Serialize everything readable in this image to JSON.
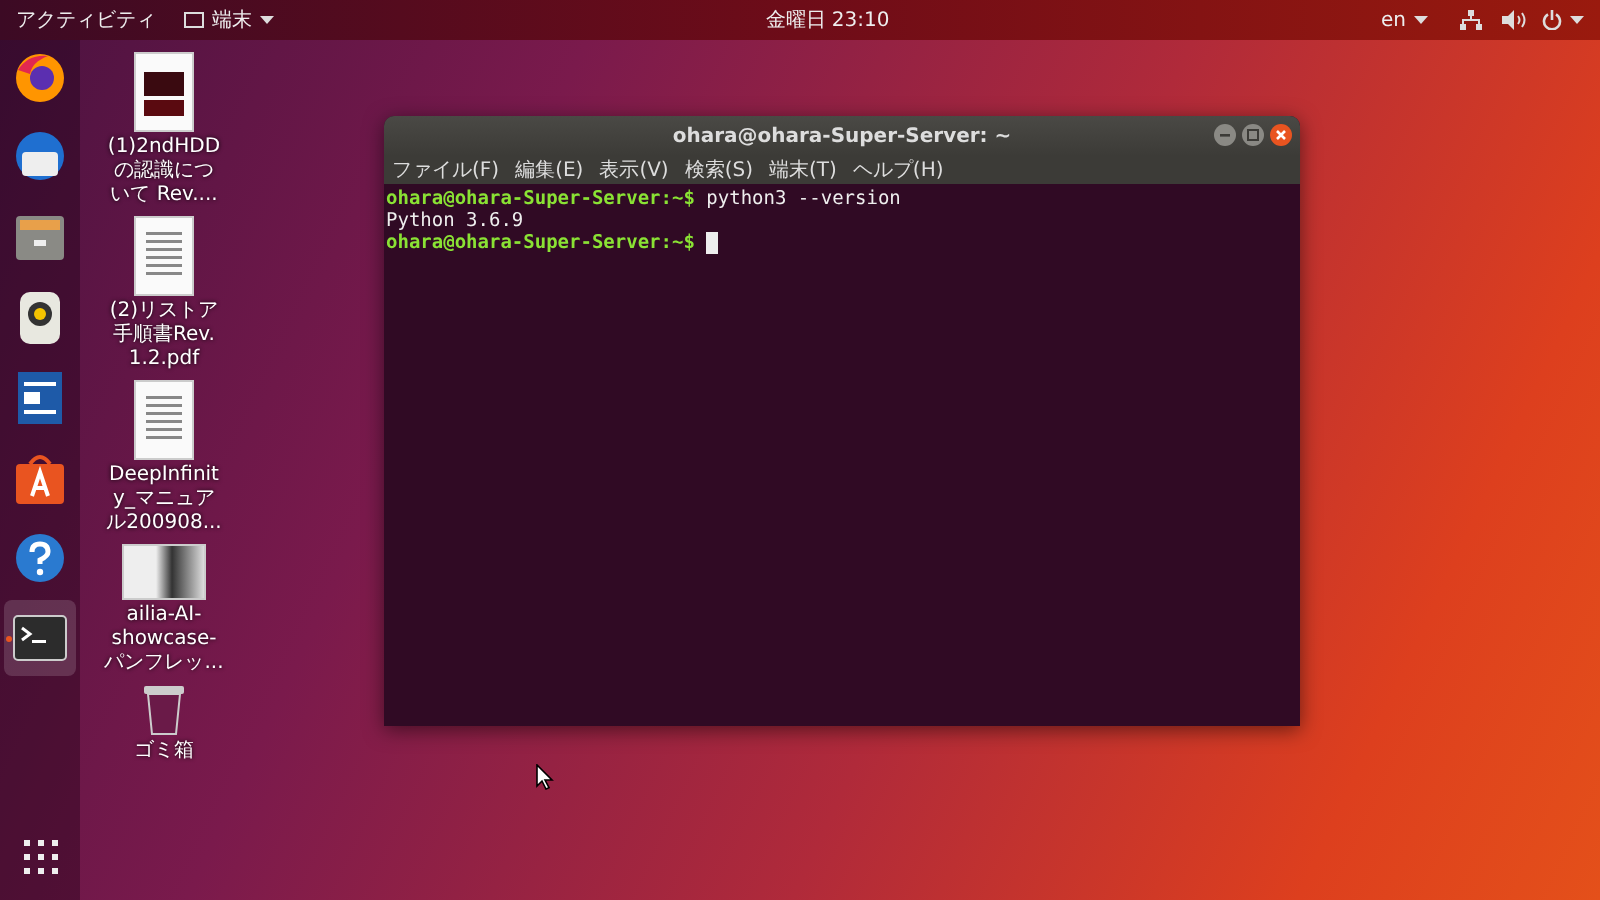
{
  "top_bar": {
    "activities": "アクティビティ",
    "app_menu": "端末",
    "clock": "金曜日 23:10",
    "input_method": "en"
  },
  "dock": [
    {
      "kind": "browser",
      "active": false
    },
    {
      "kind": "mail",
      "active": false
    },
    {
      "kind": "files",
      "active": false
    },
    {
      "kind": "music",
      "active": false
    },
    {
      "kind": "document",
      "active": false
    },
    {
      "kind": "store",
      "active": false
    },
    {
      "kind": "help",
      "active": false
    },
    {
      "kind": "terminal",
      "active": true
    }
  ],
  "desktop_icons": [
    {
      "kind": "pdf-dark",
      "lines": [
        "(1)2ndHDD",
        "の認識につ",
        "いて Rev...."
      ]
    },
    {
      "kind": "pdf",
      "lines": [
        "(2)リストア",
        "手順書Rev.",
        "1.2.pdf"
      ]
    },
    {
      "kind": "pdf",
      "lines": [
        "DeepInfinit",
        "y_マニュア",
        "ル200908..."
      ]
    },
    {
      "kind": "photo",
      "lines": [
        "ailia-AI-",
        "showcase-",
        "パンフレッ..."
      ]
    },
    {
      "kind": "trash",
      "lines": [
        "ゴミ箱"
      ]
    }
  ],
  "terminal_window": {
    "title": "ohara@ohara-Super-Server: ~",
    "menu": [
      "ファイル(F)",
      "編集(E)",
      "表示(V)",
      "検索(S)",
      "端末(T)",
      "ヘルプ(H)"
    ],
    "lines": [
      {
        "kind": "prompt",
        "prompt": "ohara@ohara-Super-Server:~$",
        "command": "python3 --version",
        "cursor": false
      },
      {
        "kind": "output",
        "text": "Python 3.6.9"
      },
      {
        "kind": "prompt",
        "prompt": "ohara@ohara-Super-Server:~$",
        "cursor": true
      }
    ]
  }
}
